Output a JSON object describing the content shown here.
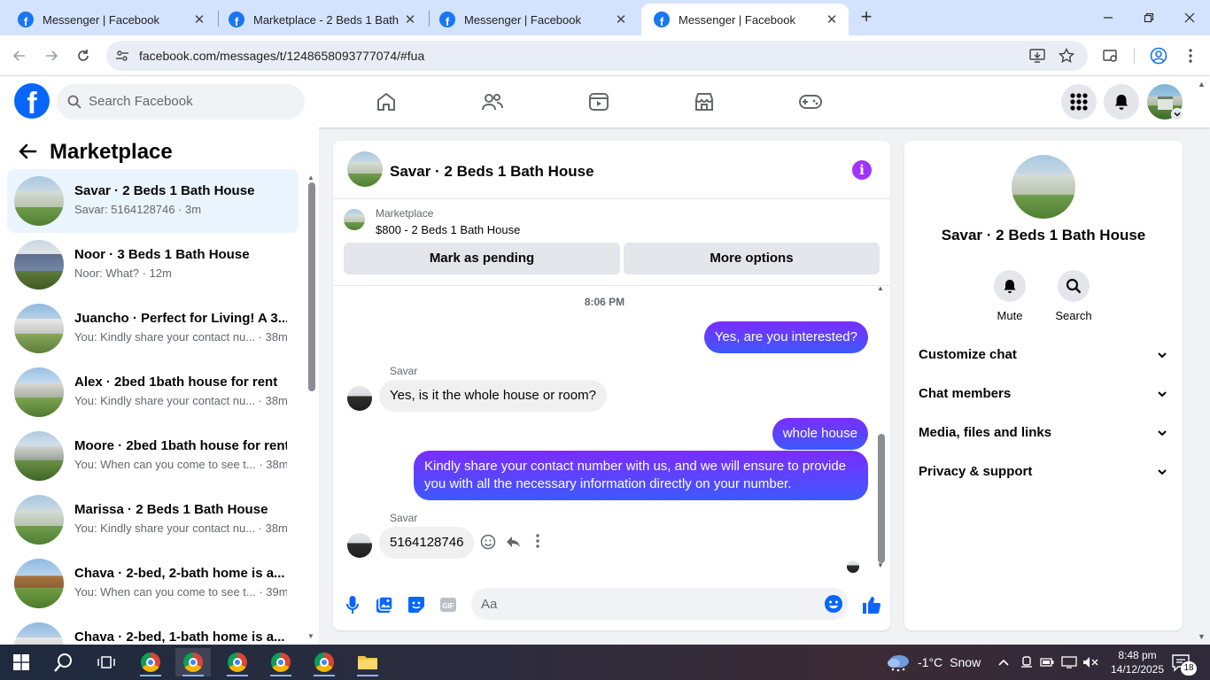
{
  "browser": {
    "tabs": [
      {
        "title": "Messenger | Facebook"
      },
      {
        "title": "Marketplace - 2 Beds 1 Bath Ho"
      },
      {
        "title": "Messenger | Facebook"
      },
      {
        "title": "Messenger | Facebook"
      }
    ],
    "url": "facebook.com/messages/t/1248658093777074/#fua"
  },
  "fb_header": {
    "search_placeholder": "Search Facebook"
  },
  "left_panel": {
    "title": "Marketplace",
    "conversations": [
      {
        "name": "Savar · 2 Beds 1 Bath House",
        "preview": "Savar: 5164128746 · 3m"
      },
      {
        "name": "Noor · 3 Beds 1 Bath House",
        "preview": "Noor: What? · 12m"
      },
      {
        "name": "Juancho · Perfect for Living! A 3...",
        "preview": "You: Kindly share your contact nu... · 38m"
      },
      {
        "name": "Alex · 2bed 1bath house for rent",
        "preview": "You: Kindly share your contact nu... · 38m"
      },
      {
        "name": "Moore · 2bed 1bath house for rent",
        "preview": "You: When can you come to see t... · 38m"
      },
      {
        "name": "Marissa · 2 Beds 1 Bath House",
        "preview": "You: Kindly share your contact nu... · 38m"
      },
      {
        "name": "Chava · 2-bed, 2-bath home is a...",
        "preview": "You: When can you come to see t... · 39m"
      },
      {
        "name": "Chava · 2-bed, 1-bath home is a...",
        "preview": ""
      }
    ]
  },
  "chat": {
    "title": "Savar · 2 Beds 1 Bath House",
    "listing_label": "Marketplace",
    "listing_price": "$800 - 2 Beds 1 Bath House",
    "mark_pending": "Mark as pending",
    "more_options": "More options",
    "timestamp": "8:06 PM",
    "messages": [
      {
        "from": "me",
        "text": "Yes, are you interested?"
      },
      {
        "from": "Savar",
        "text": "Yes, is it the whole house or room?"
      },
      {
        "from": "me",
        "text": "whole house"
      },
      {
        "from": "me",
        "text": "Kindly share your contact number with us, and we will ensure to provide you with all the necessary information directly on your number."
      },
      {
        "from": "Savar",
        "text": "5164128746"
      }
    ],
    "input_placeholder": "Aa"
  },
  "info_panel": {
    "name": "Savar · 2 Beds 1 Bath House",
    "mute_label": "Mute",
    "search_label": "Search",
    "sections": [
      "Customize chat",
      "Chat members",
      "Media, files and links",
      "Privacy & support"
    ]
  },
  "taskbar": {
    "weather_temp": "-1°C",
    "weather_desc": "Snow",
    "time": "8:48 pm",
    "date": "14/12/2025",
    "notif_count": "18"
  },
  "colors": {
    "fb_blue": "#0866ff",
    "messenger_purple": "#a033ff",
    "out_bubble_top": "#7b2cff",
    "out_bubble_bottom": "#3d5afe"
  }
}
